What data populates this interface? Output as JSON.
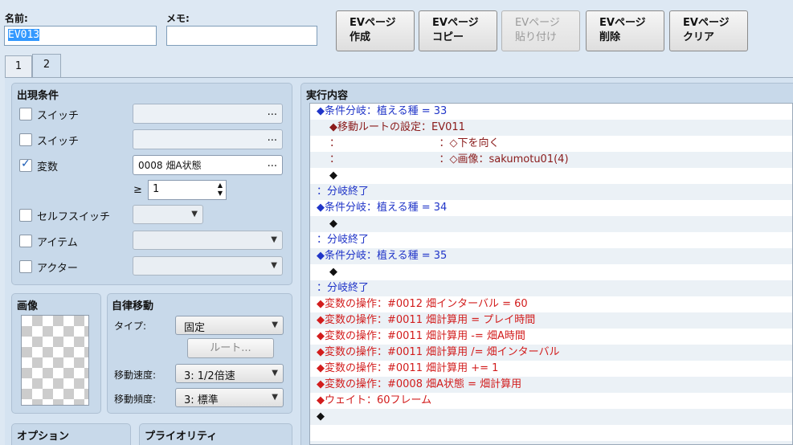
{
  "header": {
    "name_label": "名前:",
    "name_value": "EV013",
    "memo_label": "メモ:",
    "memo_value": "",
    "buttons": [
      {
        "line1": "EVページ",
        "line2": "作成",
        "enabled": true
      },
      {
        "line1": "EVページ",
        "line2": "コピー",
        "enabled": true
      },
      {
        "line1": "EVページ",
        "line2": "貼り付け",
        "enabled": false
      },
      {
        "line1": "EVページ",
        "line2": "削除",
        "enabled": true
      },
      {
        "line1": "EVページ",
        "line2": "クリア",
        "enabled": true
      }
    ]
  },
  "tabs": [
    "1",
    "2"
  ],
  "active_tab": "2",
  "conditions": {
    "title": "出現条件",
    "switch1": {
      "label": "スイッチ",
      "checked": false,
      "value": "",
      "button": "..."
    },
    "switch2": {
      "label": "スイッチ",
      "checked": false,
      "value": "",
      "button": "..."
    },
    "variable": {
      "label": "変数",
      "checked": true,
      "value": "0008 畑A状態",
      "button": "...",
      "operator": "≥",
      "operand": "1"
    },
    "self_switch": {
      "label": "セルフスイッチ",
      "checked": false,
      "value": ""
    },
    "item": {
      "label": "アイテム",
      "checked": false,
      "value": ""
    },
    "actor": {
      "label": "アクター",
      "checked": false,
      "value": ""
    }
  },
  "image": {
    "title": "画像"
  },
  "autonomous": {
    "title": "自律移動",
    "type_label": "タイプ:",
    "type_value": "固定",
    "route_button": "ルート...",
    "speed_label": "移動速度:",
    "speed_value": "3: 1/2倍速",
    "freq_label": "移動頻度:",
    "freq_value": "3: 標準"
  },
  "options": {
    "title": "オプション"
  },
  "priority": {
    "title": "プライオリティ"
  },
  "contents": {
    "title": "実行内容",
    "lines": [
      {
        "text": "◆条件分岐：植える種 = 33",
        "color": "blue",
        "indent": 0
      },
      {
        "text": "◆移動ルートの設定：EV011",
        "color": "dark",
        "indent": 1
      },
      {
        "text": "：　　　　　　　　　　：◇下を向く",
        "color": "dark",
        "indent": 1
      },
      {
        "text": "：　　　　　　　　　　：◇画像：sakumotu01(4)",
        "color": "dark",
        "indent": 1
      },
      {
        "text": "◆",
        "color": "black",
        "indent": 1
      },
      {
        "text": "：分岐終了",
        "color": "blue",
        "indent": 0
      },
      {
        "text": "◆条件分岐：植える種 = 34",
        "color": "blue",
        "indent": 0
      },
      {
        "text": "◆",
        "color": "black",
        "indent": 1
      },
      {
        "text": "：分岐終了",
        "color": "blue",
        "indent": 0
      },
      {
        "text": "◆条件分岐：植える種 = 35",
        "color": "blue",
        "indent": 0
      },
      {
        "text": "◆",
        "color": "black",
        "indent": 1
      },
      {
        "text": "：分岐終了",
        "color": "blue",
        "indent": 0
      },
      {
        "text": "◆変数の操作：#0012 畑インターバル = 60",
        "color": "red",
        "indent": 0
      },
      {
        "text": "◆変数の操作：#0011 畑計算用 = プレイ時間",
        "color": "red",
        "indent": 0
      },
      {
        "text": "◆変数の操作：#0011 畑計算用 -= 畑A時間",
        "color": "red",
        "indent": 0
      },
      {
        "text": "◆変数の操作：#0011 畑計算用 /= 畑インターバル",
        "color": "red",
        "indent": 0
      },
      {
        "text": "◆変数の操作：#0011 畑計算用 += 1",
        "color": "red",
        "indent": 0
      },
      {
        "text": "◆変数の操作：#0008 畑A状態 = 畑計算用",
        "color": "red",
        "indent": 0
      },
      {
        "text": "◆ウェイト：60フレーム",
        "color": "red",
        "indent": 0
      },
      {
        "text": "◆",
        "color": "black",
        "indent": 0
      },
      {
        "text": "",
        "color": "black",
        "indent": 0
      },
      {
        "text": "",
        "color": "black",
        "indent": 0
      }
    ]
  }
}
